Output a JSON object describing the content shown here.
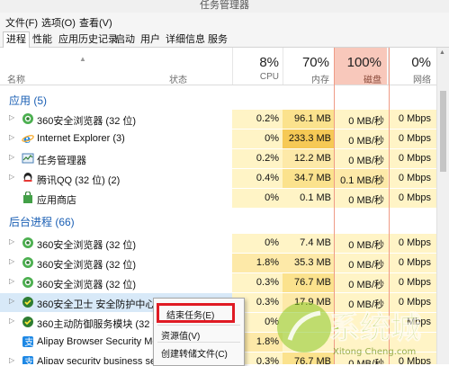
{
  "window": {
    "title": "任务管理器"
  },
  "menu": [
    "文件(F)",
    "选项(O)",
    "查看(V)"
  ],
  "tabs": [
    "进程",
    "性能",
    "应用历史记录",
    "启动",
    "用户",
    "详细信息",
    "服务"
  ],
  "active_tab": 0,
  "columns": {
    "name": "名称",
    "status": "状态",
    "cpu": {
      "pct": "8%",
      "label": "CPU"
    },
    "mem": {
      "pct": "70%",
      "label": "内存"
    },
    "disk": {
      "pct": "100%",
      "label": "磁盘"
    },
    "net": {
      "pct": "0%",
      "label": "网络"
    }
  },
  "sections": {
    "apps": "应用 (5)",
    "background": "后台进程 (66)"
  },
  "rows": [
    {
      "name": "360安全浏览器 (32 位)",
      "cpu": "0.2%",
      "mem": "96.1 MB",
      "disk": "0 MB/秒",
      "net": "0 Mbps",
      "icon": "360browser-icon",
      "expand": true
    },
    {
      "name": "Internet Explorer (3)",
      "cpu": "0%",
      "mem": "233.3 MB",
      "disk": "0 MB/秒",
      "net": "0 Mbps",
      "icon": "ie-icon",
      "expand": true
    },
    {
      "name": "任务管理器",
      "cpu": "0.2%",
      "mem": "12.2 MB",
      "disk": "0 MB/秒",
      "net": "0 Mbps",
      "icon": "taskmgr-icon",
      "expand": true
    },
    {
      "name": "腾讯QQ (32 位) (2)",
      "cpu": "0.4%",
      "mem": "34.7 MB",
      "disk": "0.1 MB/秒",
      "net": "0 Mbps",
      "icon": "qq-icon",
      "expand": true
    },
    {
      "name": "应用商店",
      "cpu": "0%",
      "mem": "0.1 MB",
      "disk": "0 MB/秒",
      "net": "0 Mbps",
      "icon": "store-icon",
      "expand": false
    },
    {
      "name": "360安全浏览器 (32 位)",
      "cpu": "0%",
      "mem": "7.4 MB",
      "disk": "0 MB/秒",
      "net": "0 Mbps",
      "icon": "360browser-icon",
      "expand": false
    },
    {
      "name": "360安全浏览器 (32 位)",
      "cpu": "1.8%",
      "mem": "35.3 MB",
      "disk": "0 MB/秒",
      "net": "0 Mbps",
      "icon": "360browser-icon",
      "expand": false
    },
    {
      "name": "360安全浏览器 (32 位)",
      "cpu": "0.3%",
      "mem": "76.7 MB",
      "disk": "0 MB/秒",
      "net": "0 Mbps",
      "icon": "360browser-icon",
      "expand": false
    },
    {
      "name": "360安全卫士 安全防护中心模块",
      "cpu": "0.3%",
      "mem": "17.9 MB",
      "disk": "0 MB/秒",
      "net": "0 Mbps",
      "icon": "360safe-icon",
      "expand": true
    },
    {
      "name": "360主动防御服务模块 (32 位)",
      "cpu": "0%",
      "mem": "",
      "disk": "",
      "net": "Mbps",
      "icon": "360safe-icon",
      "expand": true
    },
    {
      "name": "Alipay Browser Security Mo",
      "cpu": "1.8%",
      "mem": "",
      "disk": "",
      "net": "",
      "icon": "alipay-icon",
      "expand": false
    },
    {
      "name": "Alipay security business ser",
      "cpu": "0.3%",
      "mem": "76.7 MB",
      "disk": "0 MB/秒",
      "net": "0 Mbps",
      "icon": "alipay-icon",
      "expand": true
    }
  ],
  "context_menu": [
    "结束任务(E)",
    "资源值(V)",
    "创建转储文件(C)"
  ],
  "watermark": {
    "brand": "系统城",
    "url": "Xitong Cheng.com"
  }
}
